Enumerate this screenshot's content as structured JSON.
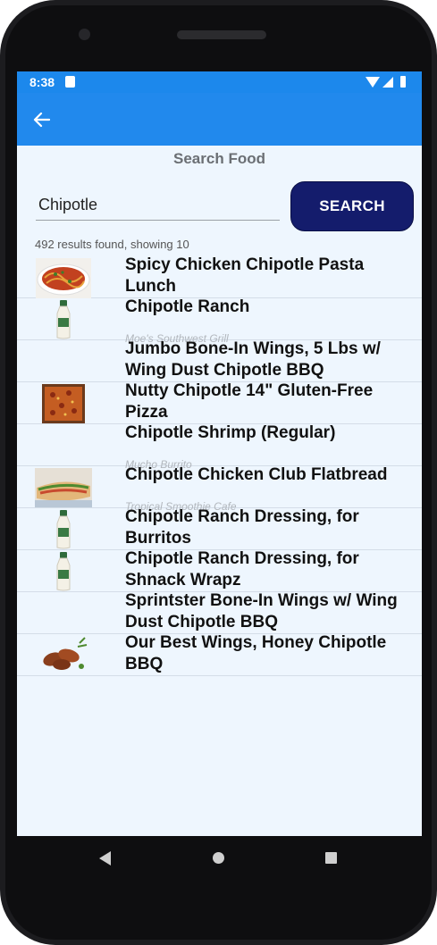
{
  "status": {
    "time": "8:38"
  },
  "page": {
    "title": "Search Food"
  },
  "search": {
    "value": "Chipotle",
    "button_label": "SEARCH"
  },
  "results": {
    "count_text": "492 results found, showing 10",
    "items": [
      {
        "name": "Spicy Chicken Chipotle Pasta Lunch",
        "sub": "",
        "icon": "pasta-thumbnail"
      },
      {
        "name": "Chipotle Ranch",
        "sub": "Moe's Southwest Grill",
        "icon": "dressing-bottle-thumbnail"
      },
      {
        "name": "Jumbo Bone-In Wings, 5 Lbs w/ Wing Dust Chipotle BBQ",
        "sub": "",
        "icon": ""
      },
      {
        "name": "Nutty Chipotle 14\" Gluten-Free Pizza",
        "sub": "",
        "icon": "pizza-thumbnail"
      },
      {
        "name": "Chipotle Shrimp (Regular)",
        "sub": "Mucho Burrito",
        "icon": ""
      },
      {
        "name": "Chipotle Chicken Club Flatbread",
        "sub": "Tropical Smoothie Cafe",
        "icon": "flatbread-thumbnail"
      },
      {
        "name": "Chipotle Ranch Dressing, for Burritos",
        "sub": "",
        "icon": "dressing-bottle-thumbnail"
      },
      {
        "name": "Chipotle Ranch Dressing, for Shnack Wrapz",
        "sub": "",
        "icon": "dressing-bottle-thumbnail"
      },
      {
        "name": "Sprintster Bone-In Wings w/ Wing Dust Chipotle BBQ",
        "sub": "",
        "icon": ""
      },
      {
        "name": "Our Best Wings, Honey Chipotle BBQ",
        "sub": "",
        "icon": "wings-thumbnail"
      }
    ]
  },
  "colors": {
    "appbar": "#2189ed",
    "button": "#141c6c",
    "background": "#eef6fe"
  }
}
